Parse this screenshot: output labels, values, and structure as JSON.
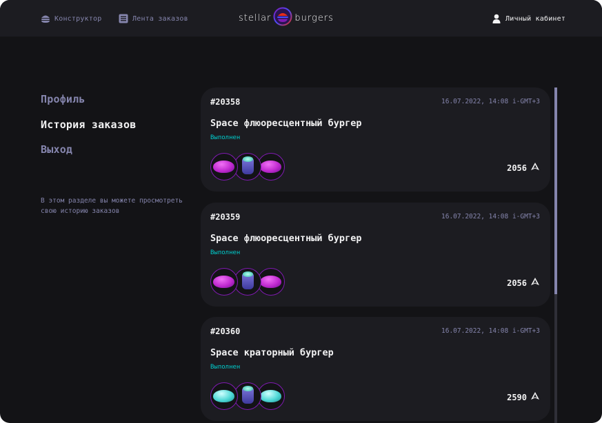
{
  "header": {
    "nav": [
      {
        "label": "Конструктор",
        "icon": "burger-icon"
      },
      {
        "label": "Лента заказов",
        "icon": "list-icon"
      }
    ],
    "logo": {
      "left": "stellar",
      "right": "burgers"
    },
    "account": {
      "label": "Личный кабинет",
      "icon": "profile-icon"
    }
  },
  "sidebar": {
    "links": [
      {
        "label": "Профиль",
        "active": false
      },
      {
        "label": "История заказов",
        "active": true
      },
      {
        "label": "Выход",
        "active": false
      }
    ],
    "note": "В этом разделе вы можете просмотреть свою историю заказов"
  },
  "orders": [
    {
      "number": "#20358",
      "date": "16.07.2022, 14:08 i-GMT+3",
      "name": "Space флюоресцентный бургер",
      "status": "Выполнен",
      "price": "2056",
      "ingredients": [
        "fluorescent-bun",
        "sauce",
        "fluorescent-bun"
      ]
    },
    {
      "number": "#20359",
      "date": "16.07.2022, 14:08 i-GMT+3",
      "name": "Space флюоресцентный бургер",
      "status": "Выполнен",
      "price": "2056",
      "ingredients": [
        "fluorescent-bun",
        "sauce",
        "fluorescent-bun"
      ]
    },
    {
      "number": "#20360",
      "date": "16.07.2022, 14:08 i-GMT+3",
      "name": "Space краторный бургер",
      "status": "Выполнен",
      "price": "2590",
      "ingredients": [
        "crater-bun",
        "sauce",
        "crater-bun"
      ]
    }
  ],
  "colors": {
    "background": "#131316",
    "panel": "#1C1C21",
    "text_primary": "#F2F2F3",
    "text_inactive": "#8585AD",
    "status_done": "#00CCCC",
    "accent": "#801AB2"
  }
}
